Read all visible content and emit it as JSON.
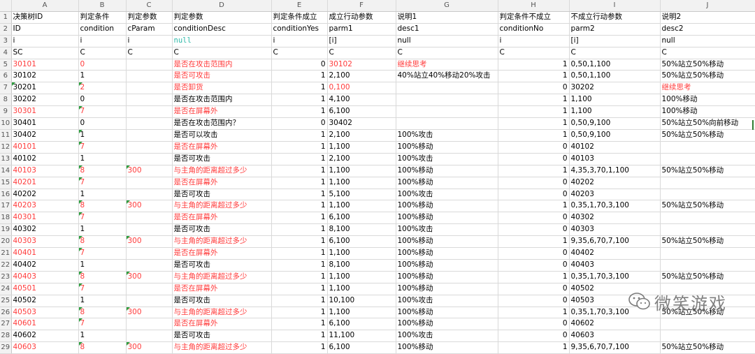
{
  "columns": [
    "A",
    "B",
    "C",
    "D",
    "E",
    "F",
    "G",
    "H",
    "I",
    "J"
  ],
  "rows": [
    {
      "n": "1",
      "c": [
        "决策树ID",
        "判定条件",
        "判定参数",
        "判定参数",
        "判定条件成立",
        "成立行动参数",
        "说明1",
        "判定条件不成立",
        "不成立行动参数",
        "说明2"
      ],
      "red": []
    },
    {
      "n": "2",
      "c": [
        "ID",
        "condition",
        "cParam",
        "conditionDesc",
        "conditionYes",
        "parm1",
        "desc1",
        "conditionNo",
        "parm2",
        "desc2"
      ],
      "red": []
    },
    {
      "n": "3",
      "c": [
        "i",
        "i",
        "i",
        "null",
        "i",
        "[i]",
        "null",
        "i",
        "[i]",
        "null"
      ],
      "red": []
    },
    {
      "n": "4",
      "c": [
        "SC",
        "C",
        "C",
        "C",
        "C",
        "C",
        "C",
        "C",
        "C",
        "C"
      ],
      "red": []
    },
    {
      "n": "5",
      "c": [
        "30101",
        "0",
        "",
        "是否在攻击范围内",
        "0",
        "30102",
        "继续思考",
        "1",
        "0,50,1,100",
        "50%站立50%移动"
      ],
      "red": [
        0,
        1,
        3,
        5,
        6
      ]
    },
    {
      "n": "6",
      "c": [
        "30102",
        "1",
        "",
        "是否可攻击",
        "1",
        "2,100",
        "40%站立40%移动20%攻击",
        "1",
        "0,50,1,100",
        "50%站立50%移动"
      ],
      "red": [
        3
      ]
    },
    {
      "n": "7",
      "c": [
        "30201",
        "2",
        "",
        "是否卸货",
        "1",
        "0,100",
        "",
        "0",
        "30202",
        "继续思考"
      ],
      "red": [
        1,
        3,
        5,
        9
      ]
    },
    {
      "n": "8",
      "c": [
        "30202",
        "0",
        "",
        "是否在攻击范围内",
        "1",
        "4,100",
        "",
        "1",
        "1,100",
        "100%移动"
      ],
      "red": []
    },
    {
      "n": "9",
      "c": [
        "30301",
        "7",
        "",
        "是否在屏幕外",
        "1",
        "6,100",
        "",
        "1",
        "1,100",
        "100%移动"
      ],
      "red": [
        0,
        1,
        3
      ]
    },
    {
      "n": "10",
      "c": [
        "30401",
        "0",
        "",
        "是否在攻击范围内？",
        "0",
        "30402",
        "",
        "1",
        "0,50,9,100",
        "50%站立50%向前移动"
      ],
      "red": []
    },
    {
      "n": "11",
      "c": [
        "30402",
        "1",
        "",
        "是否可以攻击",
        "1",
        "2,100",
        "100%攻击",
        "1",
        "0,50,9,100",
        "50%站立50%移动"
      ],
      "red": []
    },
    {
      "n": "12",
      "c": [
        "40101",
        "7",
        "",
        "是否在屏幕外",
        "1",
        "1,100",
        "100%移动",
        "0",
        "40102",
        ""
      ],
      "red": [
        0,
        1,
        3
      ]
    },
    {
      "n": "13",
      "c": [
        "40102",
        "1",
        "",
        "是否可攻击",
        "1",
        "2,100",
        "100%攻击",
        "0",
        "40103",
        ""
      ],
      "red": []
    },
    {
      "n": "14",
      "c": [
        "40103",
        "8",
        "300",
        "与主角的距离超过多少",
        "1",
        "1,100",
        "100%移动",
        "1",
        "4,35,3,70,1,100",
        "50%站立50%移动"
      ],
      "red": [
        0,
        1,
        2,
        3
      ]
    },
    {
      "n": "15",
      "c": [
        "40201",
        "7",
        "",
        "是否在屏幕外",
        "1",
        "1,100",
        "100%移动",
        "0",
        "40202",
        ""
      ],
      "red": [
        0,
        1,
        3
      ]
    },
    {
      "n": "16",
      "c": [
        "40202",
        "1",
        "",
        "是否可攻击",
        "1",
        "5,100",
        "100%攻击",
        "0",
        "40203",
        ""
      ],
      "red": []
    },
    {
      "n": "17",
      "c": [
        "40203",
        "8",
        "300",
        "与主角的距离超过多少",
        "1",
        "1,100",
        "100%移动",
        "1",
        "0,35,1,70,3,100",
        "50%站立50%移动"
      ],
      "red": [
        0,
        1,
        2,
        3
      ]
    },
    {
      "n": "18",
      "c": [
        "40301",
        "7",
        "",
        "是否在屏幕外",
        "1",
        "6,100",
        "100%移动",
        "0",
        "40302",
        ""
      ],
      "red": [
        0,
        1,
        3
      ]
    },
    {
      "n": "19",
      "c": [
        "40302",
        "1",
        "",
        "是否可攻击",
        "1",
        "8,100",
        "100%攻击",
        "0",
        "40303",
        ""
      ],
      "red": []
    },
    {
      "n": "20",
      "c": [
        "40303",
        "8",
        "300",
        "与主角的距离超过多少",
        "1",
        "6,100",
        "100%移动",
        "1",
        "9,35,6,70,7,100",
        "50%站立50%移动"
      ],
      "red": [
        0,
        1,
        2,
        3
      ]
    },
    {
      "n": "21",
      "c": [
        "40401",
        "7",
        "",
        "是否在屏幕外",
        "1",
        "1,100",
        "100%移动",
        "0",
        "40402",
        ""
      ],
      "red": [
        0,
        1,
        3
      ]
    },
    {
      "n": "22",
      "c": [
        "40402",
        "1",
        "",
        "是否可攻击",
        "1",
        "8,100",
        "100%移动",
        "0",
        "40403",
        ""
      ],
      "red": []
    },
    {
      "n": "23",
      "c": [
        "40403",
        "8",
        "300",
        "与主角的距离超过多少",
        "1",
        "1,100",
        "100%移动",
        "1",
        "0,35,1,70,3,100",
        "50%站立50%移动"
      ],
      "red": [
        0,
        1,
        2,
        3
      ]
    },
    {
      "n": "24",
      "c": [
        "40501",
        "7",
        "",
        "是否在屏幕外",
        "1",
        "1,100",
        "100%移动",
        "0",
        "40502",
        ""
      ],
      "red": [
        0,
        1,
        3
      ]
    },
    {
      "n": "25",
      "c": [
        "40502",
        "1",
        "",
        "是否可攻击",
        "1",
        "10,100",
        "100%攻击",
        "0",
        "40503",
        ""
      ],
      "red": []
    },
    {
      "n": "26",
      "c": [
        "40503",
        "8",
        "300",
        "与主角的距离超过多少",
        "1",
        "1,100",
        "100%移动",
        "1",
        "0,35,1,70,3,100",
        "50%站立50%移动"
      ],
      "red": [
        0,
        1,
        2,
        3
      ]
    },
    {
      "n": "27",
      "c": [
        "40601",
        "7",
        "",
        "是否在屏幕外",
        "1",
        "6,100",
        "100%移动",
        "0",
        "40602",
        ""
      ],
      "red": [
        0,
        1,
        3
      ]
    },
    {
      "n": "28",
      "c": [
        "40602",
        "1",
        "",
        "是否可攻击",
        "1",
        "11,100",
        "100%攻击",
        "0",
        "40603",
        ""
      ],
      "red": []
    },
    {
      "n": "29",
      "c": [
        "40603",
        "8",
        "300",
        "与主角的距离超过多少",
        "1",
        "6,100",
        "100%移动",
        "1",
        "9,35,6,70,7,100",
        "50%站立50%移动"
      ],
      "red": [
        0,
        1,
        2,
        3
      ]
    }
  ],
  "watermark": {
    "text": "微笑游戏",
    "icon": "wechat-logo-icon"
  },
  "colors": {
    "red_text": "#ff3b3b",
    "null_text": "#2eb8a8",
    "header_bg": "#f2f2f2",
    "grid": "#d9d9d9",
    "flag": "#2e9e3f"
  }
}
